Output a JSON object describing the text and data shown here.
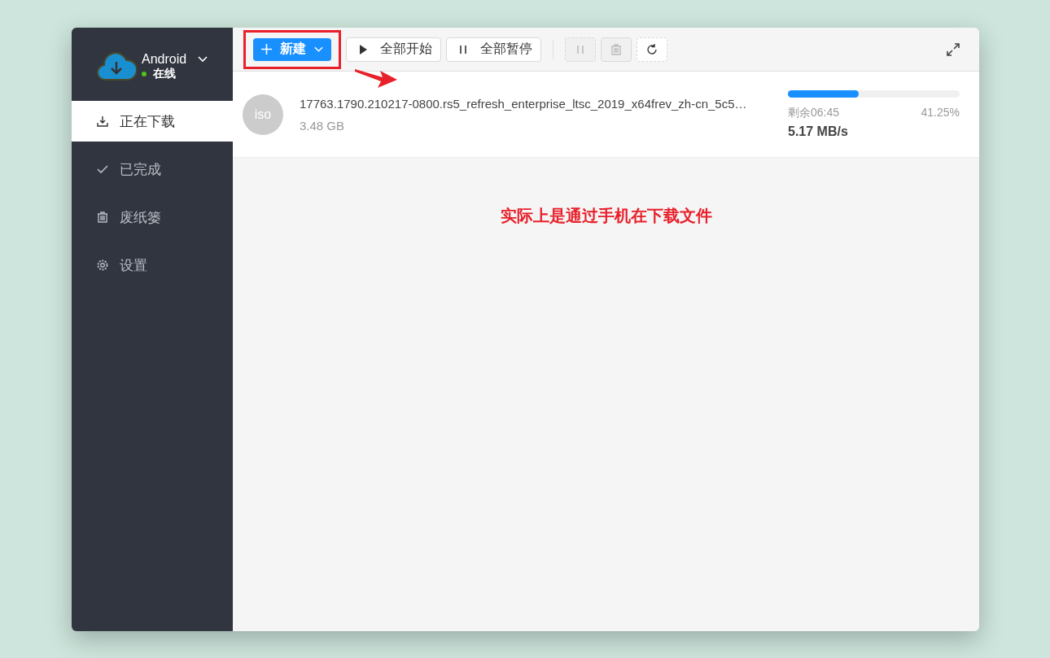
{
  "device": {
    "name": "Android",
    "status": "在线",
    "online": true
  },
  "sidebar": {
    "items": [
      {
        "kind": "download",
        "label": "正在下载",
        "selected": true
      },
      {
        "kind": "check",
        "label": "已完成",
        "selected": false
      },
      {
        "kind": "trash",
        "label": "废纸篓",
        "selected": false
      },
      {
        "kind": "gear",
        "label": "设置",
        "selected": false
      }
    ]
  },
  "toolbar": {
    "new_button": "新建",
    "buttons": [
      {
        "kind": "play",
        "label": "全部开始",
        "disabled": false
      },
      {
        "kind": "pause",
        "label": "全部暂停",
        "disabled": false
      },
      {
        "kind": "pause",
        "disabled": true
      },
      {
        "kind": "trash",
        "disabled": true
      },
      {
        "kind": "refresh",
        "disabled": false
      }
    ]
  },
  "tasks": [
    {
      "type": "iso",
      "name": "17763.1790.210217-0800.rs5_refresh_enterprise_ltsc_2019_x64frev_zh-cn_5c5…",
      "size": "3.48 GB",
      "level": 0.4125,
      "remaining": "剩余06:45",
      "percent": "41.25%",
      "speed": "5.17 MB/s"
    }
  ],
  "annotation": "实际上是通过手机在下载文件"
}
